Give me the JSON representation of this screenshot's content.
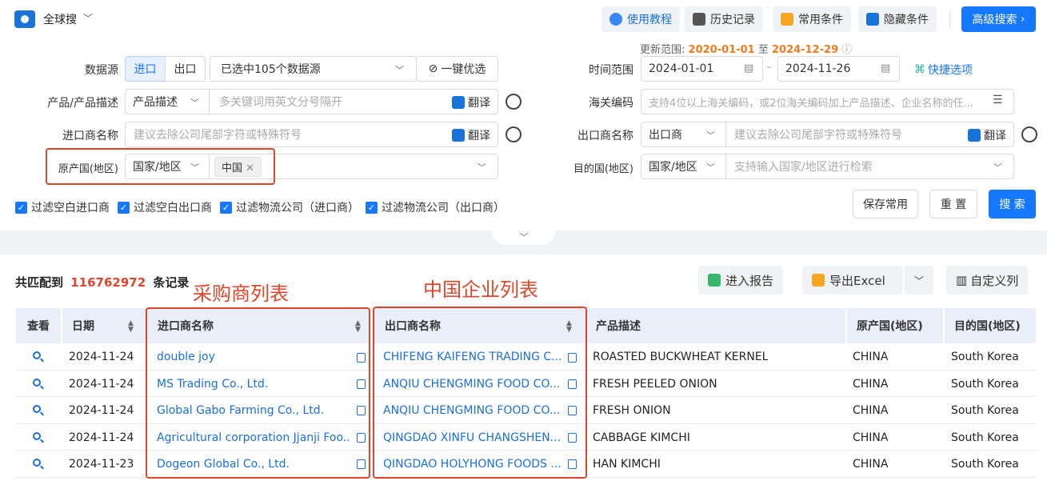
{
  "app": {
    "name": "全球搜"
  },
  "toolbar": {
    "tutorial": "使用教程",
    "history": "历史记录",
    "common": "常用条件",
    "hide": "隐藏条件",
    "advanced": "高级搜索"
  },
  "update_range": {
    "prefix": "更新范围:",
    "start": "2020-01-01",
    "sep": "至",
    "end": "2024-12-29"
  },
  "form": {
    "data_source_label": "数据源",
    "import_tab": "进口",
    "export_tab": "出口",
    "selected_sources": "已选中105个数据源",
    "one_click": "一键优选",
    "time_label": "时间范围",
    "date_start": "2024-01-01",
    "date_end": "2024-11-26",
    "quick_options": "快捷选项",
    "product_label": "产品/产品描述",
    "product_mode": "产品描述",
    "product_placeholder": "多关键词用英文分号隔开",
    "translate": "翻译",
    "hs_label": "海关编码",
    "hs_placeholder": "支持4位以上海关编码，或2位海关编码加上产品描述、企业名称的任...",
    "importer_label": "进口商名称",
    "importer_placeholder": "建议去除公司尾部字符或特殊符号",
    "exporter_label": "出口商名称",
    "exporter_mode": "出口商",
    "exporter_placeholder": "建议去除公司尾部字符或特殊符号",
    "origin_label": "原产国(地区)",
    "origin_mode": "国家/地区",
    "origin_tag": "中国",
    "dest_label": "目的国(地区)",
    "dest_mode": "国家/地区",
    "dest_placeholder": "支持输入国家/地区进行检索"
  },
  "filters": [
    "过滤空白进口商",
    "过滤空白出口商",
    "过滤物流公司（进口商）",
    "过滤物流公司（出口商）"
  ],
  "actions": {
    "save": "保存常用",
    "reset": "重 置",
    "search": "搜 索"
  },
  "results": {
    "prefix": "共匹配到",
    "count": "116762972",
    "suffix": "条记录",
    "report": "进入报告",
    "export": "导出Excel",
    "custom": "自定义列"
  },
  "annotations": {
    "buyers": "采购商列表",
    "chinese": "中国企业列表"
  },
  "table": {
    "headers": [
      "查看",
      "日期",
      "进口商名称",
      "出口商名称",
      "产品描述",
      "原产国(地区)",
      "目的国(地区)"
    ],
    "rows": [
      {
        "date": "2024-11-24",
        "importer": "double joy",
        "exporter": "CHIFENG KAIFENG TRADING C...",
        "product": "ROASTED BUCKWHEAT KERNEL",
        "origin": "CHINA",
        "dest": "South Korea"
      },
      {
        "date": "2024-11-24",
        "importer": "MS Trading Co., Ltd.",
        "exporter": "ANQIU CHENGMING FOOD CO....",
        "product": "FRESH PEELED ONION",
        "origin": "CHINA",
        "dest": "South Korea"
      },
      {
        "date": "2024-11-24",
        "importer": "Global Gabo Farming Co., Ltd.",
        "exporter": "ANQIU CHENGMING FOOD CO....",
        "product": "FRESH ONION",
        "origin": "CHINA",
        "dest": "South Korea"
      },
      {
        "date": "2024-11-24",
        "importer": "Agricultural corporation Jjanji Foo...",
        "exporter": "QINGDAO XINFU CHANGSHEN...",
        "product": "CABBAGE KIMCHI",
        "origin": "CHINA",
        "dest": "South Korea"
      },
      {
        "date": "2024-11-23",
        "importer": "Dogeon Global Co., Ltd.",
        "exporter": "QINGDAO HOLYHONG FOODS ...",
        "product": "HAN KIMCHI",
        "origin": "CHINA",
        "dest": "South Korea"
      }
    ]
  }
}
